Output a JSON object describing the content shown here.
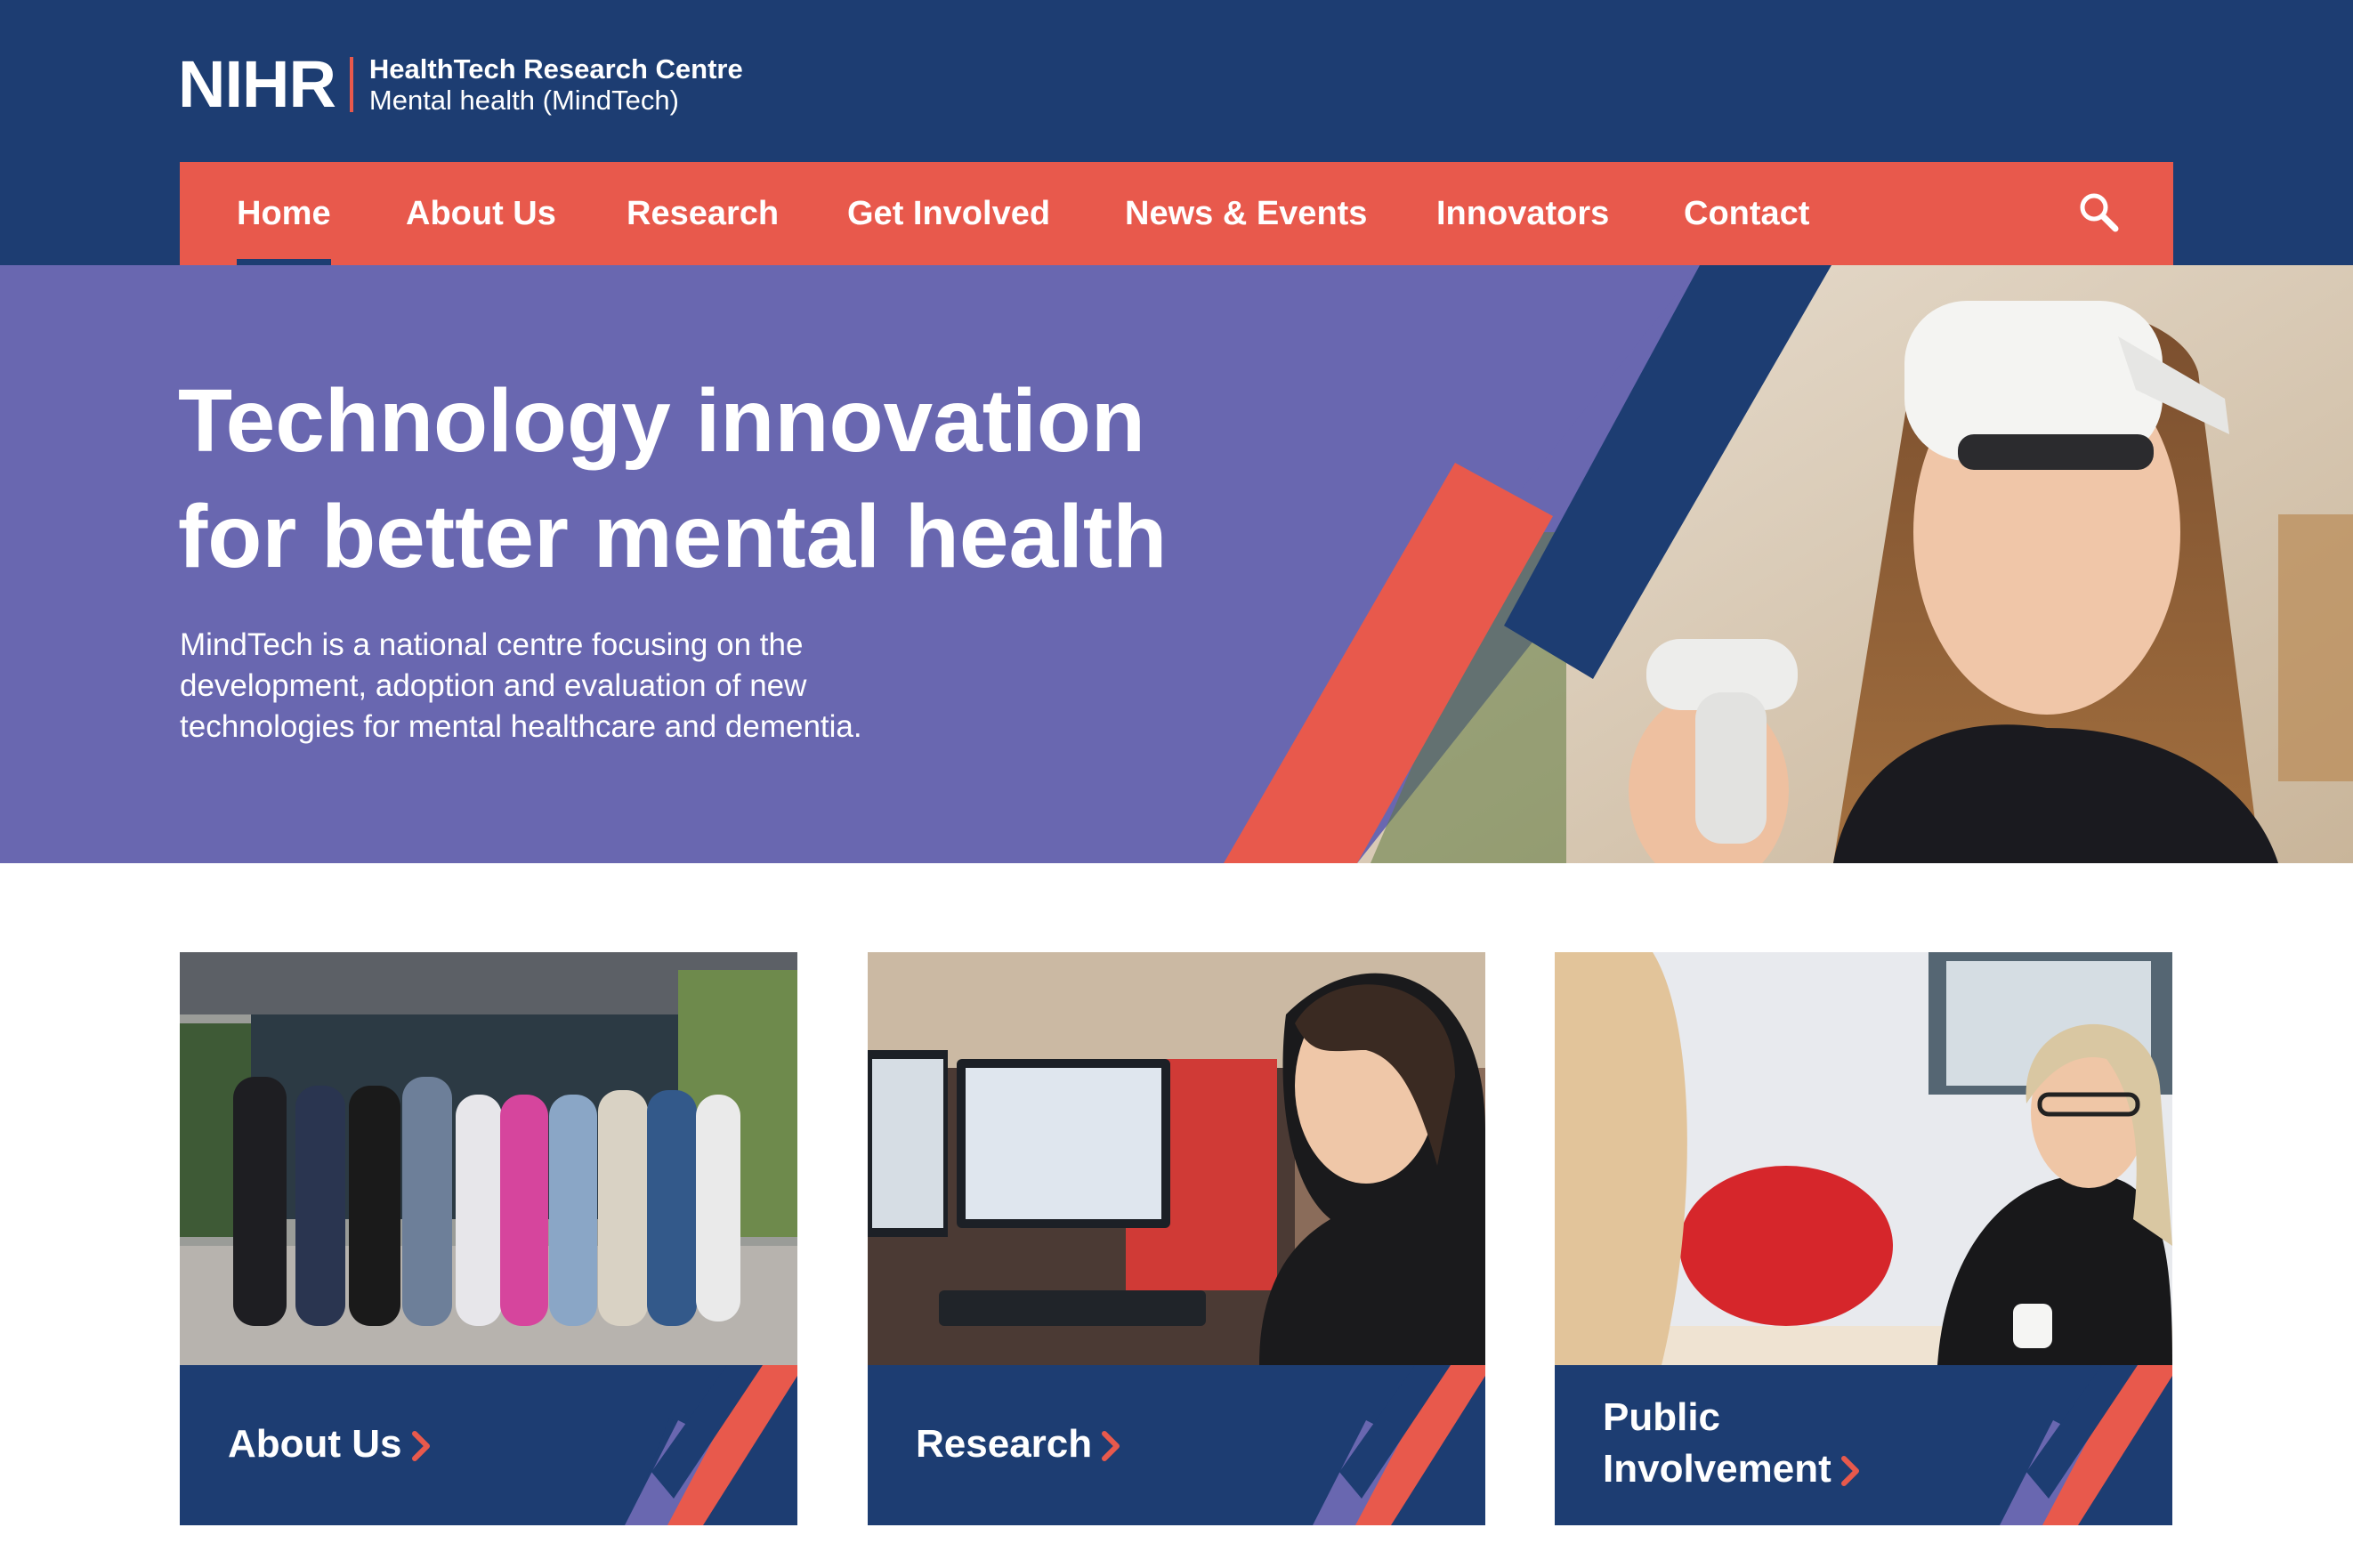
{
  "brand": {
    "mark": "NIHR",
    "line1": "HealthTech Research Centre",
    "line2": "Mental health (MindTech)"
  },
  "nav": {
    "items": [
      {
        "label": "Home",
        "active": true
      },
      {
        "label": "About Us"
      },
      {
        "label": "Research"
      },
      {
        "label": "Get Involved"
      },
      {
        "label": "News & Events"
      },
      {
        "label": "Innovators"
      },
      {
        "label": "Contact"
      }
    ],
    "search_icon": "search-icon"
  },
  "hero": {
    "title_line1": "Technology innovation",
    "title_line2": "for better mental health",
    "description": "MindTech is a national centre focusing on the development, adoption and evaluation of new technologies for mental healthcare and dementia."
  },
  "cards": [
    {
      "label": "About Us"
    },
    {
      "label": "Research"
    },
    {
      "label_line1": "Public",
      "label_line2": "Involvement"
    }
  ],
  "colors": {
    "navy": "#1d3d72",
    "coral": "#e8594c",
    "purple": "#6967b0",
    "white": "#ffffff"
  }
}
